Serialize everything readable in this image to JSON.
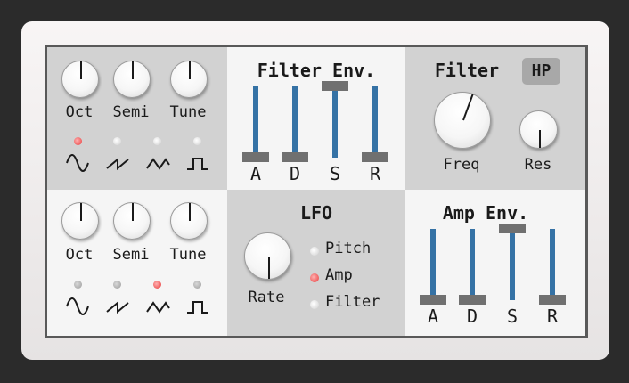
{
  "osc1": {
    "knobs": [
      "Oct",
      "Semi",
      "Tune"
    ],
    "waves": [
      "sine-wave-icon",
      "saw-wave-icon",
      "triangle-wave-icon",
      "square-wave-icon"
    ],
    "selected_wave": 0
  },
  "osc2": {
    "knobs": [
      "Oct",
      "Semi",
      "Tune"
    ],
    "waves": [
      "sine-wave-icon",
      "saw-wave-icon",
      "triangle-wave-icon",
      "square-wave-icon"
    ],
    "selected_wave": 2
  },
  "filter_env": {
    "title": "Filter Env.",
    "sliders": [
      {
        "label": "A",
        "level": 0.0
      },
      {
        "label": "D",
        "level": 0.0
      },
      {
        "label": "S",
        "level": 1.0
      },
      {
        "label": "R",
        "level": 0.0
      }
    ]
  },
  "filter": {
    "title": "Filter",
    "mode": "HP",
    "freq_label": "Freq",
    "res_label": "Res"
  },
  "lfo": {
    "title": "LFO",
    "rate_label": "Rate",
    "targets": [
      "Pitch",
      "Amp",
      "Filter"
    ],
    "selected_target": 1
  },
  "amp_env": {
    "title": "Amp Env.",
    "sliders": [
      {
        "label": "A",
        "level": 0.0
      },
      {
        "label": "D",
        "level": 0.0
      },
      {
        "label": "S",
        "level": 1.0
      },
      {
        "label": "R",
        "level": 0.0
      }
    ]
  },
  "colors": {
    "slider_track": "#3572a5",
    "slider_cap": "#707070",
    "led_active": "#e83a3a"
  }
}
